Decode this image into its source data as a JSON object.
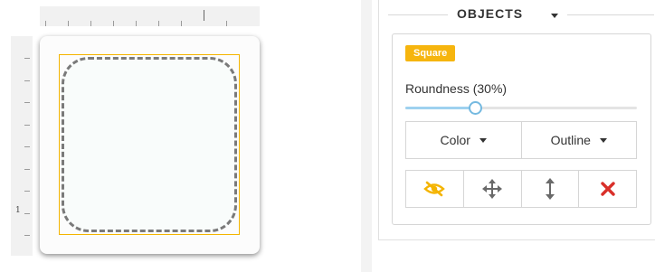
{
  "canvas": {
    "ruler_vertical_label": "1",
    "shape_roundness_fraction": 0.3
  },
  "panel": {
    "section_title": "OBJECTS",
    "object_type_badge": "Square",
    "roundness_label": "Roundness (30%)",
    "roundness_value_percent": 30,
    "color_button_label": "Color",
    "outline_button_label": "Outline",
    "actions": [
      {
        "name": "visibility-hidden-icon",
        "color": "#f4b400"
      },
      {
        "name": "move-icon",
        "color": "#666666"
      },
      {
        "name": "resize-vertical-icon",
        "color": "#666666"
      },
      {
        "name": "delete-icon",
        "color": "#d9302a"
      }
    ]
  },
  "colors": {
    "accent": "#f4b400",
    "slider": "#74b9e0",
    "delete": "#d9302a"
  }
}
